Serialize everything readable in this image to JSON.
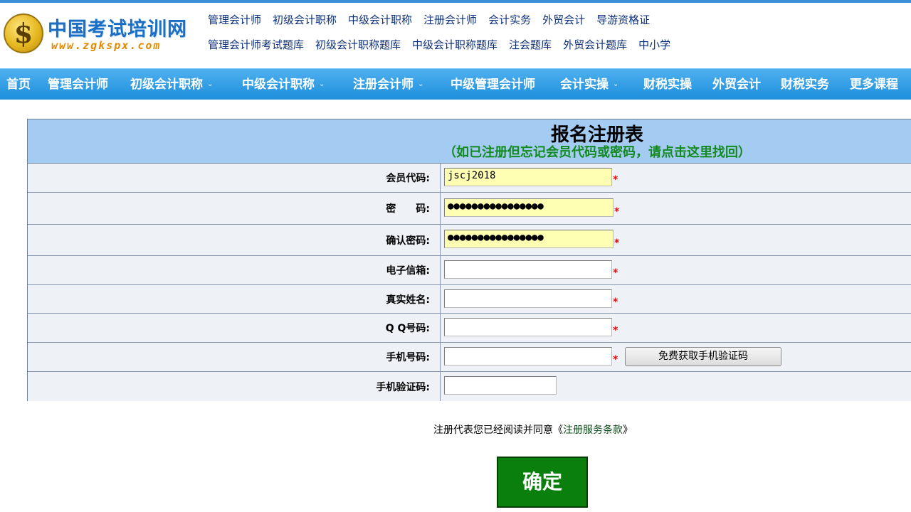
{
  "logo": {
    "title": "中国考试培训网",
    "url": "www.zgkspx.com",
    "coin_symbol": "$"
  },
  "top_links": {
    "row1": [
      "管理会计师",
      "初级会计职称",
      "中级会计职称",
      "注册会计师",
      "会计实务",
      "外贸会计",
      "导游资格证"
    ],
    "row2": [
      "管理会计师考试题库",
      "初级会计职称题库",
      "中级会计职称题库",
      "注会题库",
      "外贸会计题库",
      "中小学"
    ]
  },
  "nav": {
    "items": [
      {
        "label": "首页",
        "dropdown": false
      },
      {
        "label": "管理会计师",
        "dropdown": false
      },
      {
        "label": "初级会计职称",
        "dropdown": true
      },
      {
        "label": "中级会计职称",
        "dropdown": true
      },
      {
        "label": "注册会计师",
        "dropdown": true
      },
      {
        "label": "中级管理会计师",
        "dropdown": false
      },
      {
        "label": "会计实操",
        "dropdown": true
      },
      {
        "label": "财税实操",
        "dropdown": false
      },
      {
        "label": "外贸会计",
        "dropdown": false
      },
      {
        "label": "财税实务",
        "dropdown": false
      },
      {
        "label": "更多课程",
        "dropdown": false
      }
    ],
    "chevron": "⌄"
  },
  "form": {
    "title": "报名注册表",
    "subtitle": "（如已注册但忘记会员代码或密码，请点击这里找回）",
    "required_mark": "*",
    "fields": {
      "member_code": {
        "label": "会员代码:",
        "value": "jscj2018"
      },
      "password": {
        "label": "密　　码:",
        "value": "●●●●●●●●●●●●●●●●"
      },
      "confirm_password": {
        "label": "确认密码:",
        "value": "●●●●●●●●●●●●●●●●"
      },
      "email": {
        "label": "电子信箱:",
        "value": ""
      },
      "real_name": {
        "label": "真实姓名:",
        "value": ""
      },
      "qq": {
        "label": "Q Q号码:",
        "value": ""
      },
      "phone": {
        "label": "手机号码:",
        "value": ""
      },
      "sms_code": {
        "label": "手机验证码:",
        "value": ""
      }
    },
    "sms_button": "免费获取手机验证码"
  },
  "terms": {
    "prefix": "注册代表您已经阅读并同意",
    "open": "《",
    "link": "注册服务条款",
    "close": "》"
  },
  "submit": "确定",
  "colors": {
    "nav_bg": "#1d8fdc",
    "form_header_bg": "#a4cbf2",
    "subtitle": "#138a20",
    "autofill": "#ffffb4",
    "required": "#e01010",
    "submit_bg": "#0b7f0e"
  }
}
